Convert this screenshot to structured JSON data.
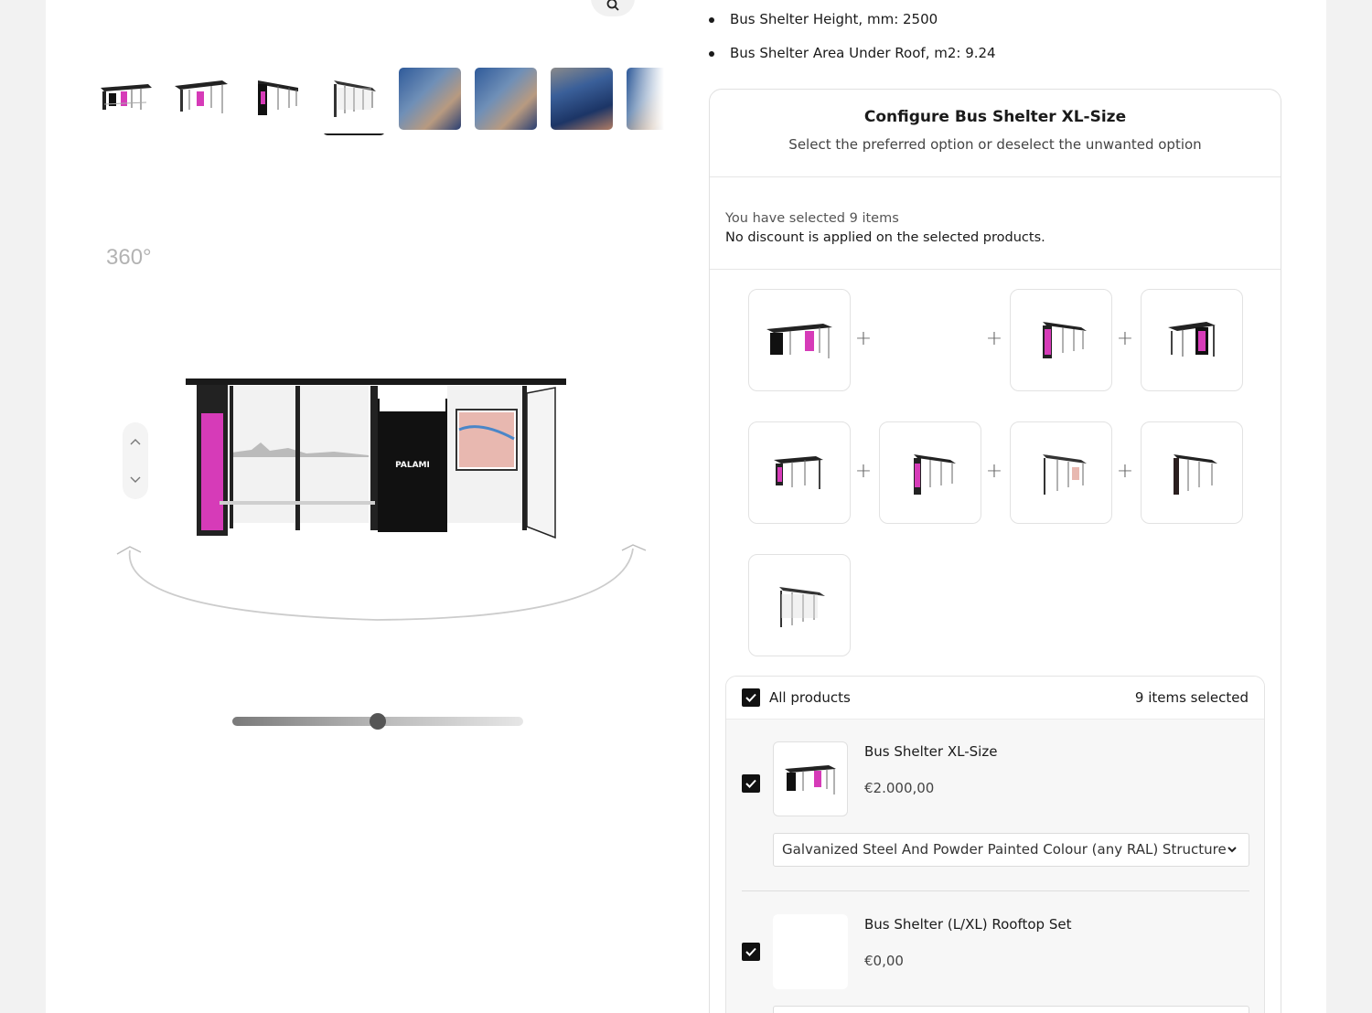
{
  "gallery": {
    "label_360": "360°",
    "thumbnails": [
      {
        "kind": "render",
        "alt": "shelter-thumb"
      },
      {
        "kind": "render",
        "alt": "shelter-thumb"
      },
      {
        "kind": "render",
        "alt": "shelter-thumb"
      },
      {
        "kind": "render",
        "alt": "shelter-thumb",
        "active": true
      },
      {
        "kind": "photo",
        "alt": "photo-thumb"
      },
      {
        "kind": "photo",
        "alt": "photo-thumb"
      },
      {
        "kind": "photo",
        "alt": "photo-thumb"
      },
      {
        "kind": "photo",
        "alt": "photo-thumb"
      }
    ],
    "viewer_brand": "PALAMI",
    "rotation_value": 0.5
  },
  "specs": [
    "Bus Shelter Height, mm: 2500",
    "Bus Shelter Area Under Roof, m2: 9.24"
  ],
  "configurator": {
    "title": "Configure Bus Shelter XL-Size",
    "subtitle": "Select the preferred option or deselect the unwanted option",
    "selected_text": "You have selected 9 items",
    "discount_text": "No discount is applied on the selected products.",
    "bundle_tiles": [
      "render",
      "photo",
      "render",
      "render",
      "render",
      "render",
      "render",
      "render",
      "render"
    ],
    "plus_sign": "+",
    "all_products_label": "All products",
    "items_selected_label": "9 items selected",
    "products": [
      {
        "name": "Bus Shelter XL-Size",
        "price": "€2.000,00",
        "option": "Galvanized Steel And Powder Painted Colour (any RAL) Structure",
        "checked": true
      },
      {
        "name": "Bus Shelter (L/XL) Rooftop Set",
        "price": "€0,00",
        "checked": true
      }
    ]
  },
  "colors": {
    "accent": "#111111",
    "ad_pink": "#d63bb8",
    "photo_blue": "#2f5a9a"
  }
}
